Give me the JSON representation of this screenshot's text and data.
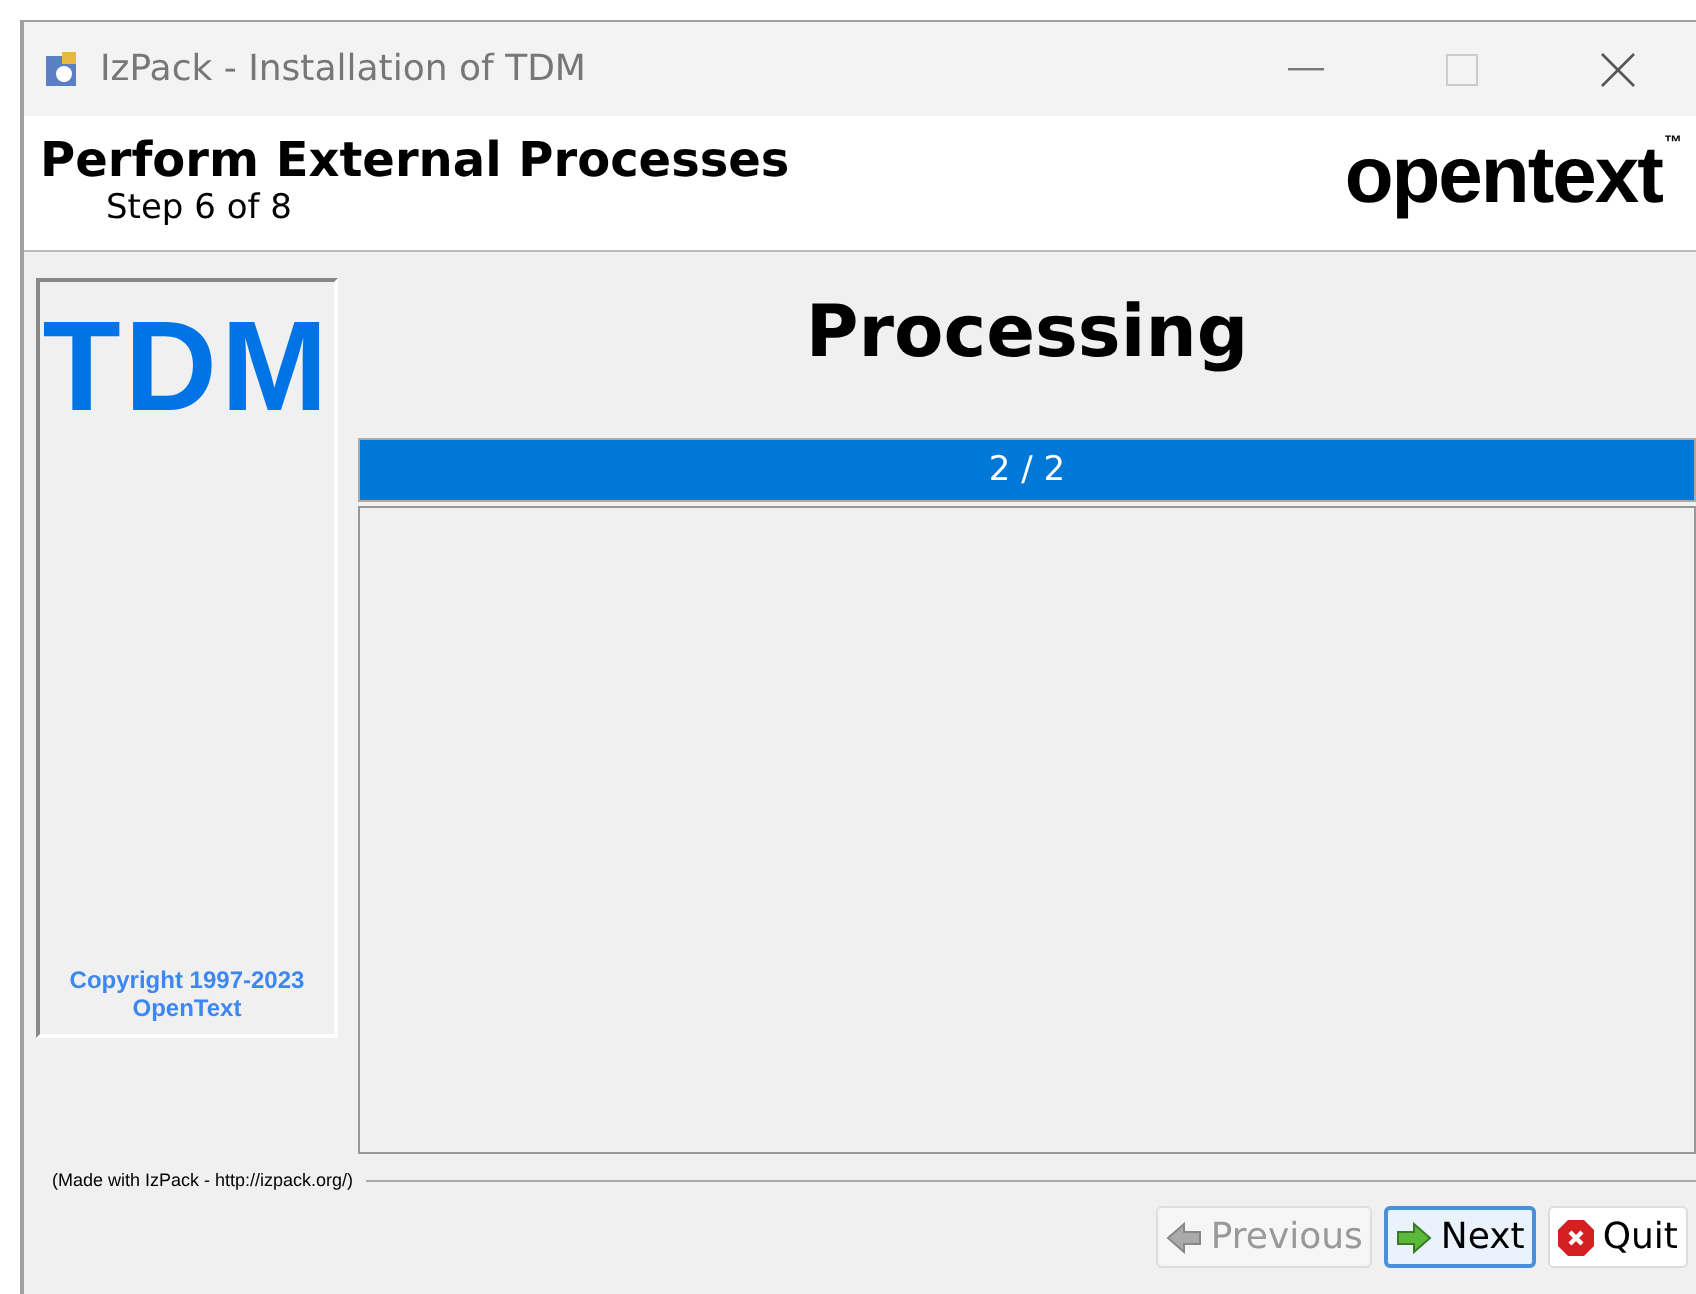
{
  "window": {
    "title": "IzPack - Installation of TDM"
  },
  "header": {
    "title": "Perform External Processes",
    "step": "Step 6 of 8",
    "logo": "opentext",
    "logo_mark": "™"
  },
  "sidebar": {
    "logo": "TDM",
    "copyright": "Copyright 1997-2023",
    "company": "OpenText"
  },
  "main": {
    "heading": "Processing",
    "progress": {
      "level": 1,
      "reading": "2 / 2"
    }
  },
  "footer": {
    "credit": "(Made with IzPack - http://izpack.org/)"
  },
  "buttons": [
    {
      "label": "Previous",
      "kind": "previous",
      "disabled": true,
      "focused": false
    },
    {
      "label": "Next",
      "kind": "next",
      "disabled": false,
      "focused": true
    },
    {
      "label": "Quit",
      "kind": "quit",
      "disabled": false,
      "focused": false
    }
  ]
}
